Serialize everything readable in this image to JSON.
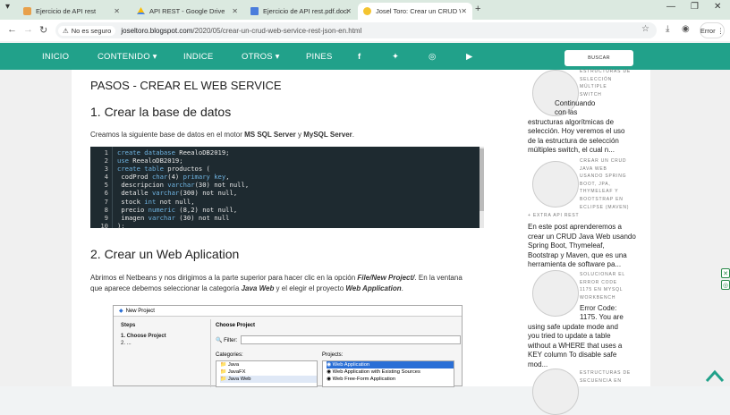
{
  "tabs": [
    {
      "title": "Ejercicio de API rest",
      "icon": "green-doc-icon"
    },
    {
      "title": "API REST - Google Drive",
      "icon": "google-drive-icon"
    },
    {
      "title": "Ejercicio de API rest.pdf.docx - ...",
      "icon": "docs-icon"
    },
    {
      "title": "Josel Toro: Crear un CRUD Web...",
      "icon": "blog-avatar-icon"
    }
  ],
  "address": {
    "security": "No es seguro",
    "domain": "joseltoro.blogspot.com",
    "path": "/2020/05/crear-un-crud-web-service-rest-json-en.html",
    "error_button": "Error"
  },
  "nav": {
    "items": [
      "INICIO",
      "CONTENIDO",
      "INDICE",
      "OTROS",
      "PINES"
    ],
    "search_button": "BUSCAR"
  },
  "article": {
    "heading": "PASOS - CREAR EL WEB SERVICE",
    "section1": "1. Crear la base de datos",
    "intro_pre": "Creamos la siguiente base de datos en el motor ",
    "intro_b1": "MS SQL Server",
    "intro_mid": " y ",
    "intro_b2": "MySQL Server",
    "intro_post": ".",
    "code_lines": [
      "1",
      "2",
      "3",
      "4",
      "5",
      "6",
      "7",
      "8",
      "9",
      "10"
    ],
    "section2": "2. Crear un Web Aplication",
    "p2_a": "Abrimos el Netbeans y nos dirigimos a la parte superior para hacer clic en la opción ",
    "p2_b": "File/New Project/",
    "p2_c": ". En la ventana",
    "p3_a": "que aparece debemos seleccionar la categoría ",
    "p3_b": "Java Web",
    "p3_c": " y el elegir el proyecto ",
    "p3_d": "Web Application",
    "p3_e": "."
  },
  "netbeans": {
    "title": "New Project",
    "steps_title": "Steps",
    "step1": "1.      Choose Project",
    "step2": "2.      ...",
    "choose": "Choose Project",
    "filter": "Filter:",
    "categories_label": "Categories:",
    "projects_label": "Projects:",
    "categories": [
      "Java",
      "JavaFX",
      "Java Web"
    ],
    "projects": [
      "Web Application",
      "Web Application with Existing Sources",
      "Web Free-Form Application"
    ]
  },
  "sidebar": {
    "post1_small": [
      "ESTRUCTURAS DE",
      "SELECCIÓN",
      "MÚLTIPLE",
      "SWITCH"
    ],
    "post1_text": [
      "Continuando",
      "con las",
      "estructuras algorítmicas de",
      "selección. Hoy veremos el uso",
      "de la estructura de selección",
      "múltiples switch, el cual n..."
    ],
    "post2_small": [
      "CREAR UN CRUD",
      "JAVA WEB",
      "USANDO SPRING",
      "BOOT, JPA,",
      "THYMELEAF Y",
      "BOOTSTRAP EN",
      "ECLIPSE (MAVEN)",
      "+ EXTRA API REST"
    ],
    "post2_text": [
      "En este post aprenderemos a",
      "crear un CRUD Java Web usando",
      "Spring Boot, Thymeleaf,",
      "Bootstrap  y Maven, que es una",
      "herramienta de software pa..."
    ],
    "post3_small": [
      "SOLUCIONAR EL",
      "ERROR CODE",
      "1175 EN MYSQL",
      "WORKBENCH"
    ],
    "post3_text": [
      "Error Code:",
      "1175. You are",
      "using safe update mode and",
      "you tried to update a table",
      "without a WHERE that uses a",
      "KEY column To disable safe",
      "mod..."
    ],
    "post4_small": [
      "ESTRUCTURAS DE",
      "SECUENCIA EN"
    ]
  },
  "colors": {
    "nav": "#21a18a",
    "tabstrip": "#dbe9e0"
  }
}
